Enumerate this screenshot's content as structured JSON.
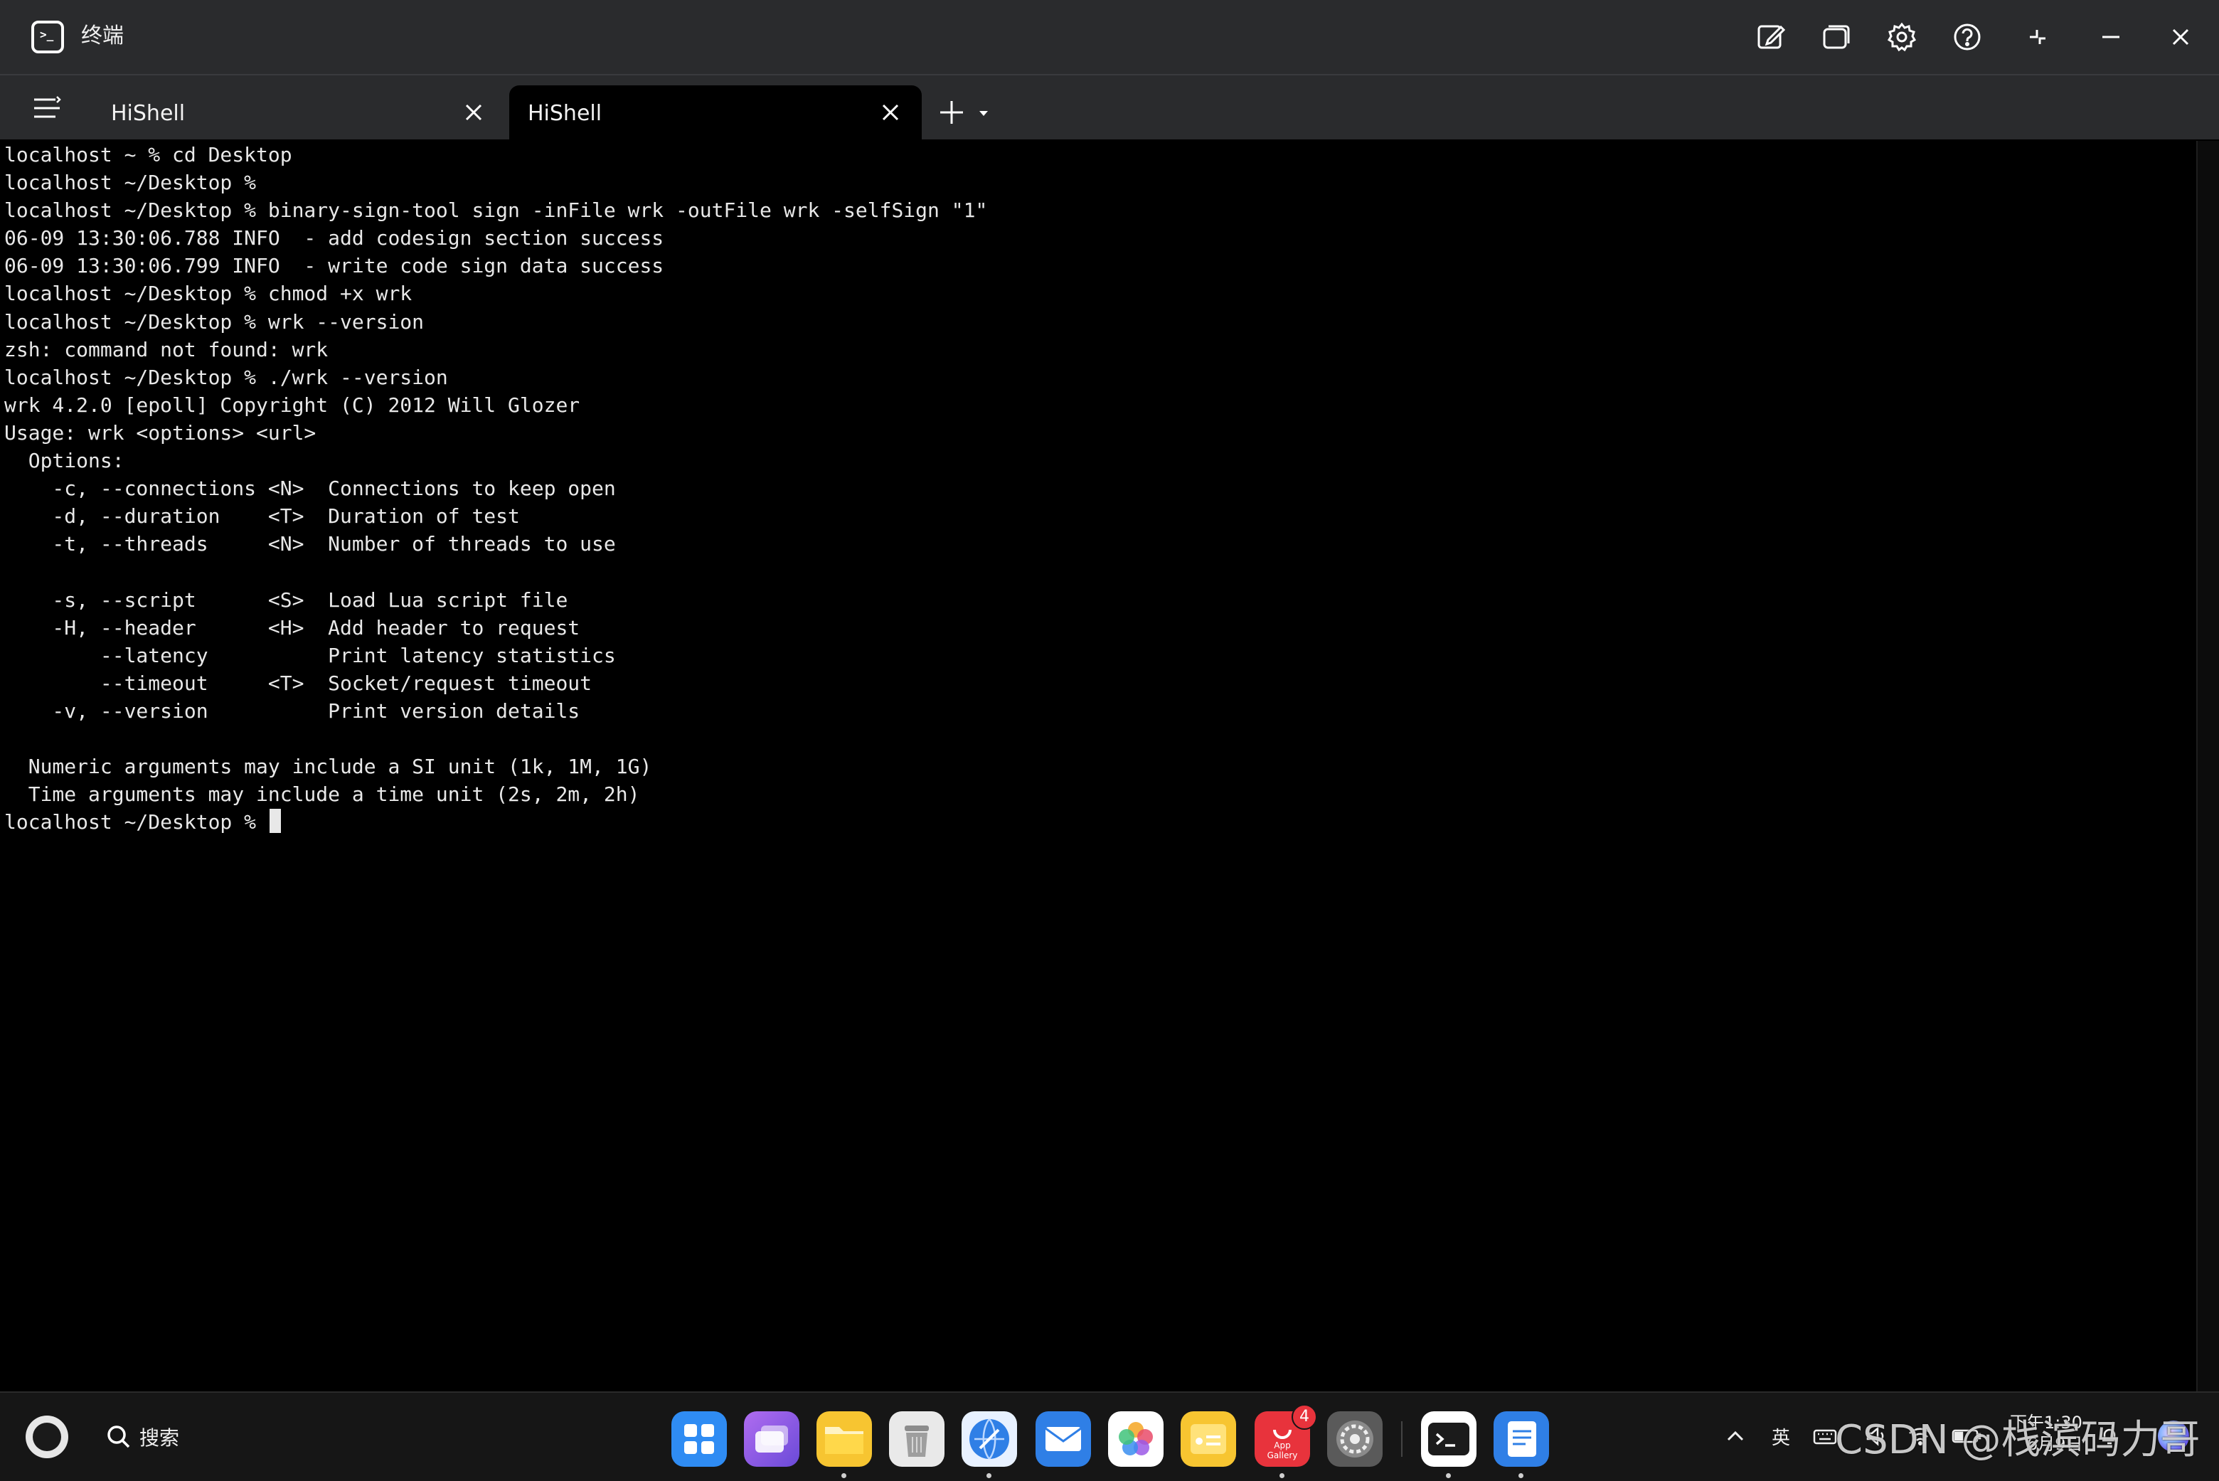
{
  "window": {
    "title": "终端",
    "controls": [
      "edit-icon",
      "restore-window-icon",
      "settings-icon",
      "help-icon",
      "shrink-icon",
      "minimize-icon",
      "close-icon"
    ]
  },
  "tabs": [
    {
      "label": "HiShell",
      "active": false
    },
    {
      "label": "HiShell",
      "active": true
    }
  ],
  "terminal": {
    "lines": [
      "localhost ~ % cd Desktop",
      "localhost ~/Desktop %",
      "localhost ~/Desktop % binary-sign-tool sign -inFile wrk -outFile wrk -selfSign \"1\"",
      "06-09 13:30:06.788 INFO  - add codesign section success",
      "06-09 13:30:06.799 INFO  - write code sign data success",
      "localhost ~/Desktop % chmod +x wrk",
      "localhost ~/Desktop % wrk --version",
      "zsh: command not found: wrk",
      "localhost ~/Desktop % ./wrk --version",
      "wrk 4.2.0 [epoll] Copyright (C) 2012 Will Glozer",
      "Usage: wrk <options> <url>",
      "  Options:",
      "    -c, --connections <N>  Connections to keep open",
      "    -d, --duration    <T>  Duration of test",
      "    -t, --threads     <N>  Number of threads to use",
      "",
      "    -s, --script      <S>  Load Lua script file",
      "    -H, --header      <H>  Add header to request",
      "        --latency          Print latency statistics",
      "        --timeout     <T>  Socket/request timeout",
      "    -v, --version          Print version details",
      "",
      "  Numeric arguments may include a SI unit (1k, 1M, 1G)",
      "  Time arguments may include a time unit (2s, 2m, 2h)"
    ],
    "prompt": "localhost ~/Desktop % "
  },
  "taskbar": {
    "search_label": "搜索",
    "apps": [
      {
        "name": "app-center-icon",
        "color": "#2f8cf3",
        "running": false
      },
      {
        "name": "multitask-icon",
        "color": "#8a5be0",
        "running": false
      },
      {
        "name": "files-icon",
        "color": "#f7c531",
        "running": true
      },
      {
        "name": "trash-icon",
        "color": "#bfbfbf",
        "running": false
      },
      {
        "name": "browser-icon",
        "color": "#2f7fe6",
        "running": true
      },
      {
        "name": "mail-icon",
        "color": "#2f7fe6",
        "running": false
      },
      {
        "name": "photos-icon",
        "color": "#ffffff",
        "running": false
      },
      {
        "name": "notes-icon",
        "color": "#f7c531",
        "running": false
      },
      {
        "name": "app-gallery-icon",
        "color": "#e8333c",
        "running": true,
        "badge": "4",
        "label": "App Gallery"
      },
      {
        "name": "system-settings-icon",
        "color": "#6b6b6b",
        "running": false
      },
      {
        "name": "terminal-icon",
        "color": "#ffffff",
        "running": true
      },
      {
        "name": "documents-icon",
        "color": "#2f7fe6",
        "running": true
      }
    ],
    "tray": {
      "input_method": "英",
      "time": "下午1:30",
      "date": "6月9日"
    }
  },
  "watermark": "CSDN @栈滨码力哥"
}
